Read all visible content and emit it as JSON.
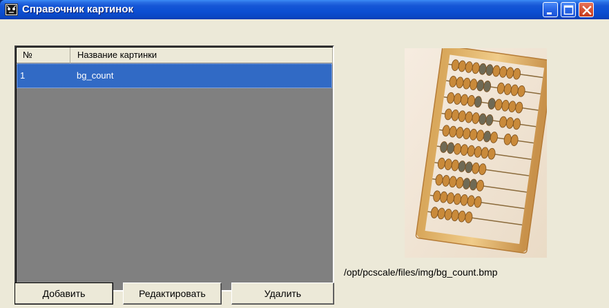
{
  "window": {
    "title": "Справочник картинок",
    "icon": "cat-app-icon",
    "controls": [
      "minimize",
      "maximize",
      "close"
    ]
  },
  "table": {
    "columns": [
      "№",
      "Название картинки"
    ],
    "rows": [
      {
        "num": "1",
        "name": "bg_count"
      }
    ],
    "selected_row": 0
  },
  "buttons": {
    "add": "Добавить",
    "edit": "Редактировать",
    "delete": "Удалить"
  },
  "preview": {
    "image": "abacus",
    "path": "/opt/pcscale/files/img/bg_count.bmp"
  },
  "colors": {
    "selection": "#316ac5",
    "list_background": "#808080",
    "dialog_background": "#ece9d8",
    "titlebar": "#0c4fd2",
    "close_button": "#d85434"
  }
}
